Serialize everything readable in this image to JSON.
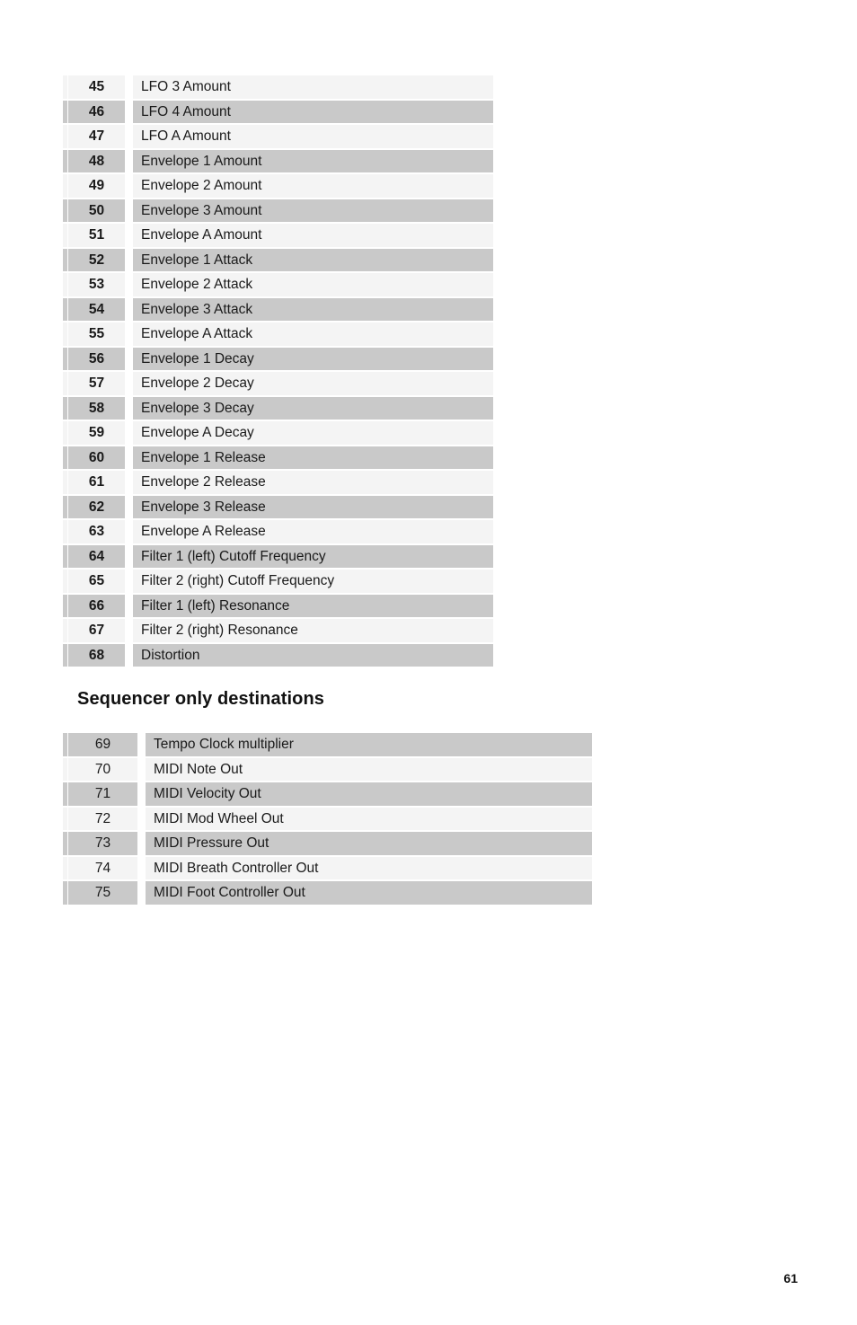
{
  "page": {
    "number": "61"
  },
  "destinations_table": {
    "rows": [
      {
        "number": "45",
        "label": "LFO 3 Amount",
        "shade": "light"
      },
      {
        "number": "46",
        "label": "LFO 4 Amount",
        "shade": "dark"
      },
      {
        "number": "47",
        "label": "LFO A Amount",
        "shade": "light"
      },
      {
        "number": "48",
        "label": "Envelope 1 Amount",
        "shade": "dark"
      },
      {
        "number": "49",
        "label": "Envelope 2 Amount",
        "shade": "light"
      },
      {
        "number": "50",
        "label": "Envelope 3 Amount",
        "shade": "dark"
      },
      {
        "number": "51",
        "label": "Envelope A Amount",
        "shade": "light"
      },
      {
        "number": "52",
        "label": "Envelope 1 Attack",
        "shade": "dark"
      },
      {
        "number": "53",
        "label": "Envelope 2 Attack",
        "shade": "light"
      },
      {
        "number": "54",
        "label": "Envelope 3 Attack",
        "shade": "dark"
      },
      {
        "number": "55",
        "label": "Envelope A Attack",
        "shade": "light"
      },
      {
        "number": "56",
        "label": "Envelope 1 Decay",
        "shade": "dark"
      },
      {
        "number": "57",
        "label": "Envelope 2 Decay",
        "shade": "light"
      },
      {
        "number": "58",
        "label": "Envelope 3 Decay",
        "shade": "dark"
      },
      {
        "number": "59",
        "label": "Envelope A Decay",
        "shade": "light"
      },
      {
        "number": "60",
        "label": "Envelope 1 Release",
        "shade": "dark"
      },
      {
        "number": "61",
        "label": "Envelope 2 Release",
        "shade": "light"
      },
      {
        "number": "62",
        "label": "Envelope 3 Release",
        "shade": "dark"
      },
      {
        "number": "63",
        "label": "Envelope A Release",
        "shade": "light"
      },
      {
        "number": "64",
        "label": "Filter 1 (left) Cutoff Frequency",
        "shade": "dark"
      },
      {
        "number": "65",
        "label": "Filter 2 (right) Cutoff Frequency",
        "shade": "light"
      },
      {
        "number": "66",
        "label": "Filter 1 (left) Resonance",
        "shade": "dark"
      },
      {
        "number": "67",
        "label": "Filter 2 (right) Resonance",
        "shade": "light"
      },
      {
        "number": "68",
        "label": "Distortion",
        "shade": "dark"
      }
    ]
  },
  "sequencer_section": {
    "heading": "Sequencer only destinations",
    "rows": [
      {
        "number": "69",
        "label": "Tempo Clock multiplier",
        "shade": "dark"
      },
      {
        "number": "70",
        "label": "MIDI Note Out",
        "shade": "light"
      },
      {
        "number": "71",
        "label": "MIDI Velocity Out",
        "shade": "dark"
      },
      {
        "number": "72",
        "label": "MIDI Mod Wheel Out",
        "shade": "light"
      },
      {
        "number": "73",
        "label": "MIDI Pressure Out",
        "shade": "dark"
      },
      {
        "number": "74",
        "label": "MIDI Breath Controller Out",
        "shade": "light"
      },
      {
        "number": "75",
        "label": "MIDI Foot Controller Out",
        "shade": "dark"
      }
    ]
  },
  "colors": {
    "row_dark": "#c9c9c9",
    "row_light": "#f4f4f4",
    "text": "#1a1a1a",
    "page_background": "#ffffff"
  }
}
